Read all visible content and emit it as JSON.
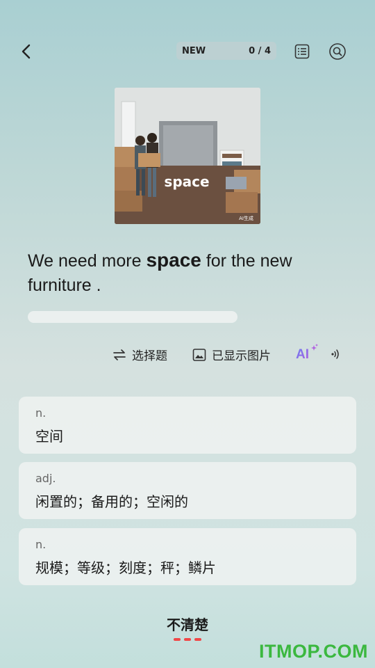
{
  "header": {
    "progress_label": "NEW",
    "progress_count": "0 / 4"
  },
  "image": {
    "word_overlay": "space",
    "ai_badge": "AI生成"
  },
  "sentence": {
    "before": "We need more ",
    "keyword": "space",
    "after": " for the new furniture ."
  },
  "toolbar": {
    "mode_label": "选择题",
    "image_toggle_label": "已显示图片",
    "ai_label": "AI"
  },
  "options": [
    {
      "pos": "n.",
      "meaning": "空间"
    },
    {
      "pos": "adj.",
      "meaning": "闲置的；备用的；空闲的"
    },
    {
      "pos": "n.",
      "meaning": "规模；等级；刻度；秤；鳞片"
    }
  ],
  "footer": {
    "unsure_label": "不清楚"
  },
  "watermark": "ITMOP.COM",
  "colors": {
    "accent_dash": "#f04848",
    "watermark": "#3bb83f",
    "ai_gradient_start": "#6b7cf0",
    "ai_gradient_end": "#b060e0"
  }
}
